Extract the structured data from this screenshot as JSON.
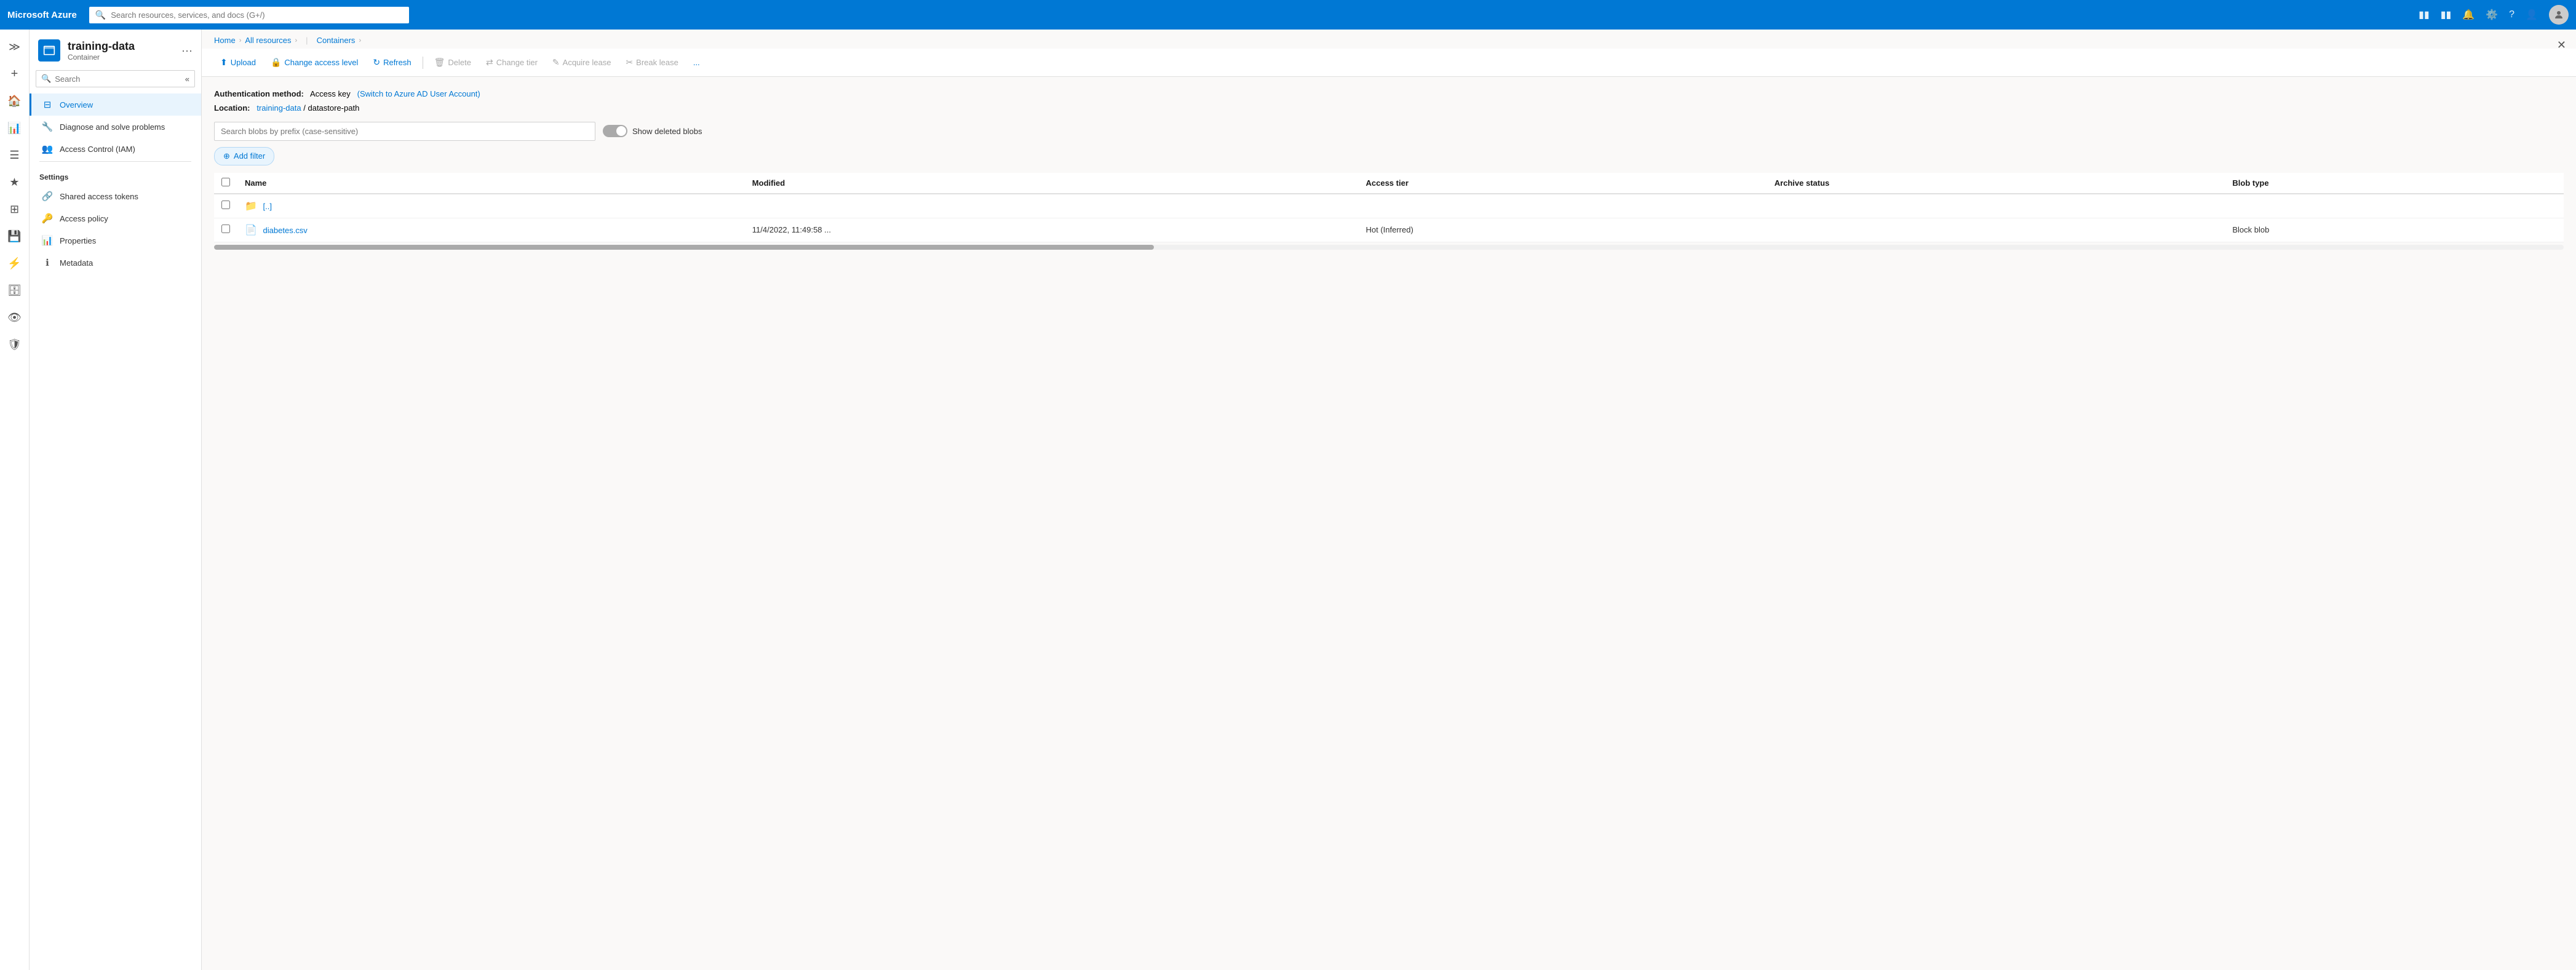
{
  "topnav": {
    "brand": "Microsoft Azure",
    "search_placeholder": "Search resources, services, and docs (G+/)",
    "icons": [
      "terminal-icon",
      "feedback-icon",
      "bell-icon",
      "settings-icon",
      "help-icon",
      "account-icon"
    ]
  },
  "breadcrumb": {
    "home": "Home",
    "all_resources": "All resources",
    "containers": "Containers"
  },
  "resource": {
    "name": "training-data",
    "type": "Container"
  },
  "side_search": {
    "placeholder": "Search"
  },
  "nav": {
    "overview": "Overview",
    "diagnose": "Diagnose and solve problems",
    "iam": "Access Control (IAM)",
    "settings_title": "Settings",
    "shared_access_tokens": "Shared access tokens",
    "access_policy": "Access policy",
    "properties": "Properties",
    "metadata": "Metadata"
  },
  "toolbar": {
    "upload": "Upload",
    "change_access_level": "Change access level",
    "refresh": "Refresh",
    "delete": "Delete",
    "change_tier": "Change tier",
    "acquire_lease": "Acquire lease",
    "break_lease": "Break lease",
    "more": "..."
  },
  "auth": {
    "label": "Authentication method:",
    "method": "Access key",
    "switch_text": "(Switch to Azure AD User Account)",
    "location_label": "Location:",
    "location_account": "training-data",
    "location_sep": "/",
    "location_path": "datastore-path"
  },
  "blob_search": {
    "placeholder": "Search blobs by prefix (case-sensitive)"
  },
  "show_deleted": "Show deleted blobs",
  "add_filter": "+ Add filter",
  "table": {
    "columns": [
      "Name",
      "Modified",
      "Access tier",
      "Archive status",
      "Blob type"
    ],
    "rows": [
      {
        "type": "folder",
        "name": "[..]",
        "modified": "",
        "access_tier": "",
        "archive_status": "",
        "blob_type": ""
      },
      {
        "type": "file",
        "name": "diabetes.csv",
        "modified": "11/4/2022, 11:49:58 ...",
        "access_tier": "Hot (Inferred)",
        "archive_status": "",
        "blob_type": "Block blob"
      }
    ]
  },
  "colors": {
    "azure_blue": "#0078d4",
    "nav_bg": "#fff",
    "topbar_bg": "#0078d4"
  }
}
